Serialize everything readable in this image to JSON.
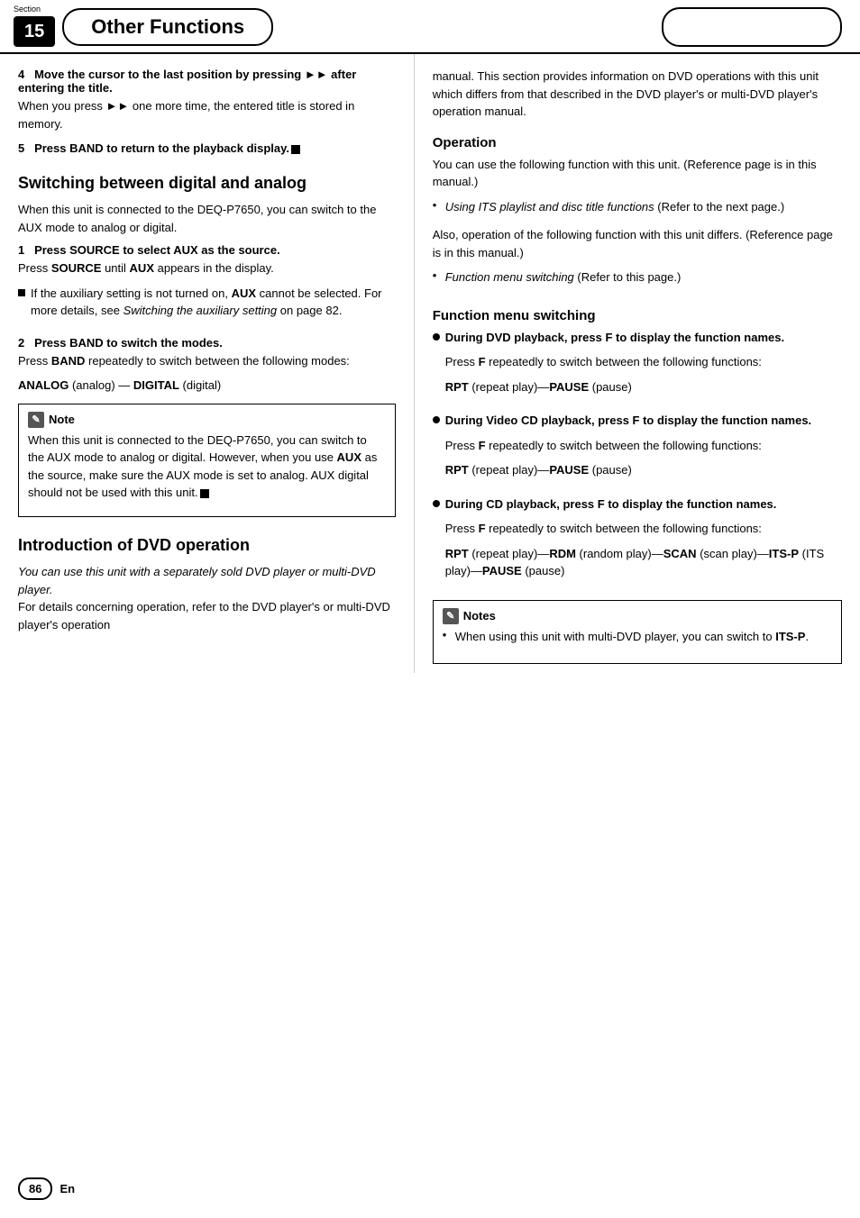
{
  "header": {
    "section_label": "Section",
    "section_number": "15",
    "title": "Other Functions",
    "right_pill": ""
  },
  "left_column": {
    "step4_title": "4   Move the cursor to the last position by pressing ►► after entering the title.",
    "step4_body": "When you press ►► one more time, the entered title is stored in memory.",
    "step5_title": "5   Press BAND to return to the playback display.",
    "section1_heading": "Switching between digital and analog",
    "section1_intro": "When this unit is connected to the DEQ-P7650, you can switch to the AUX mode to analog or digital.",
    "step1_title": "1   Press SOURCE to select AUX as the source.",
    "step1_body1": "Press SOURCE until AUX appears in the display.",
    "step1_body2": "If the auxiliary setting is not turned on, AUX cannot be selected. For more details, see Switching the auxiliary setting on page 82.",
    "step2_title": "2   Press BAND to switch the modes.",
    "step2_body1": "Press BAND repeatedly to switch between the following modes:",
    "step2_body2": "ANALOG (analog) — DIGITAL (digital)",
    "note_title": "Note",
    "note_body": "When this unit is connected to the DEQ-P7650, you can switch to the AUX mode to analog or digital. However, when you use AUX as the source, make sure the AUX mode is set to analog. AUX digital should not be used with this unit.",
    "section2_heading": "Introduction of DVD operation",
    "section2_intro_italic": "You can use this unit with a separately sold DVD player or multi-DVD player.",
    "section2_body": "For details concerning operation, refer to the DVD player's or multi-DVD player's operation"
  },
  "right_column": {
    "right_body1": "manual. This section provides information on DVD operations with this unit which differs from that described in the DVD player's or multi-DVD player's operation manual.",
    "op_heading": "Operation",
    "op_body1": "You can use the following function with this unit. (Reference page is in this manual.)",
    "op_bullet1_italic": "Using ITS playlist and disc title functions",
    "op_bullet1_plain": "(Refer to the next page.)",
    "op_body2": "Also, operation of the following function with this unit differs. (Reference page is in this manual.)",
    "op_bullet2_italic": "Function menu switching",
    "op_bullet2_plain": "(Refer to this page.)",
    "fms_heading": "Function menu switching",
    "fms_bullet1_title": "During DVD playback, press F to display the function names.",
    "fms_bullet1_body": "Press F repeatedly to switch between the following functions:",
    "fms_bullet1_functions": "RPT (repeat play)—PAUSE (pause)",
    "fms_bullet2_title": "During Video CD playback, press F to display the function names.",
    "fms_bullet2_body": "Press F repeatedly to switch between the following functions:",
    "fms_bullet2_functions": "RPT (repeat play)—PAUSE (pause)",
    "fms_bullet3_title": "During CD playback, press F to display the function names.",
    "fms_bullet3_body": "Press F repeatedly to switch between the following functions:",
    "fms_bullet3_functions": "RPT (repeat play)—RDM (random play)—SCAN (scan play)—ITS-P (ITS play)—PAUSE (pause)",
    "notes_title": "Notes",
    "notes_bullet1": "When using this unit with multi-DVD player, you can switch to ITS-P."
  },
  "footer": {
    "page_number": "86",
    "lang": "En"
  }
}
